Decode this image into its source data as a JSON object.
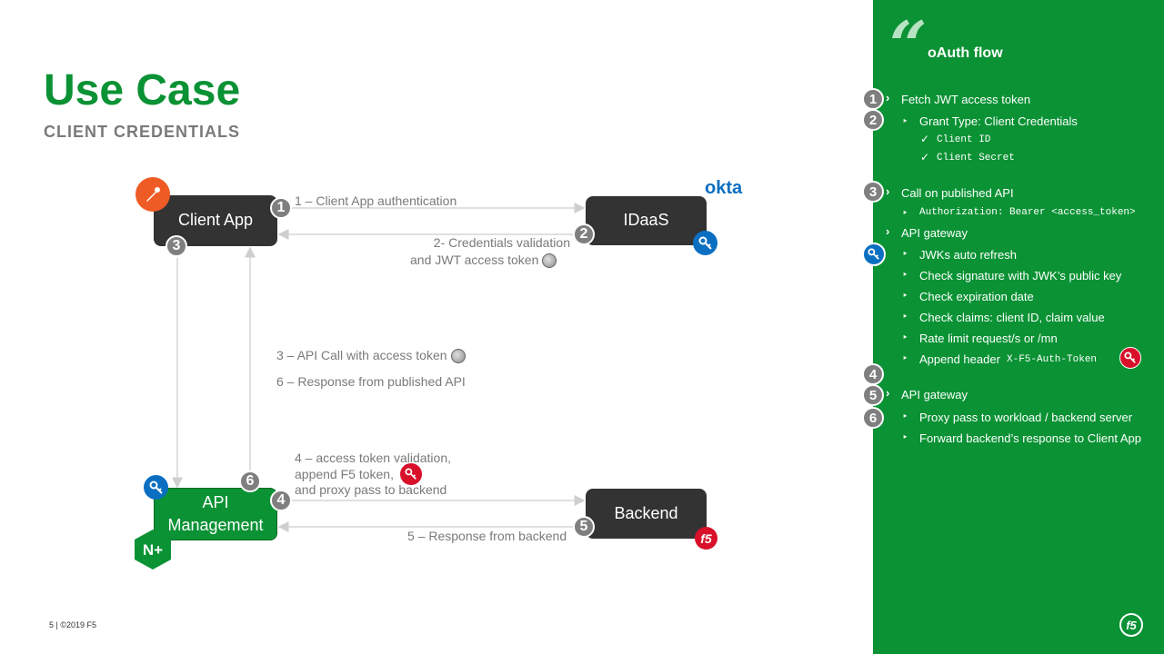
{
  "slide": {
    "title": "Use Case",
    "subtitle": "CLIENT CREDENTIALS",
    "footer": "5 | ©2019 F5"
  },
  "nodes": {
    "client_app": "Client App",
    "idaas": "IDaaS",
    "api_management": "API\nManagement",
    "backend": "Backend",
    "okta_logo": "okta",
    "nginx_logo": "N+"
  },
  "steps": {
    "s1": "1",
    "s2": "2",
    "s3": "3",
    "s4": "4",
    "s5": "5",
    "s6": "6"
  },
  "edges": {
    "e1": "1 – Client App authentication",
    "e2_line1": "2- Credentials validation",
    "e2_line2": "and JWT access token",
    "e3": "3 – API Call with access token",
    "e6": "6 – Response from published API",
    "e4_line1": "4 – access token validation,",
    "e4_line2": "append F5 token,",
    "e4_line3": "and proxy pass to backend",
    "e5": "5 – Response from backend"
  },
  "panel": {
    "title": "oAuth flow",
    "items": [
      "Fetch JWT access token",
      "Grant Type: Client Credentials",
      "Client ID",
      "Client Secret",
      "Call on published API",
      "Authorization: Bearer <access_token>",
      "API gateway",
      "JWKs auto refresh",
      "Check signature with JWK’s public key",
      "Check expiration date",
      "Check claims: client ID, claim value",
      "Rate limit request/s or /mn",
      "Append header",
      "X-F5-Auth-Token",
      "API gateway",
      "Proxy pass to workload / backend server",
      "Forward backend’s response to Client App"
    ],
    "logo": "f5"
  },
  "colors": {
    "brand_green": "#0a9234",
    "node_dark": "#333333",
    "step_grey": "#7f7f7f",
    "key_blue": "#0b6fc1",
    "key_red": "#d8102a",
    "postman_orange": "#ef5b25"
  }
}
